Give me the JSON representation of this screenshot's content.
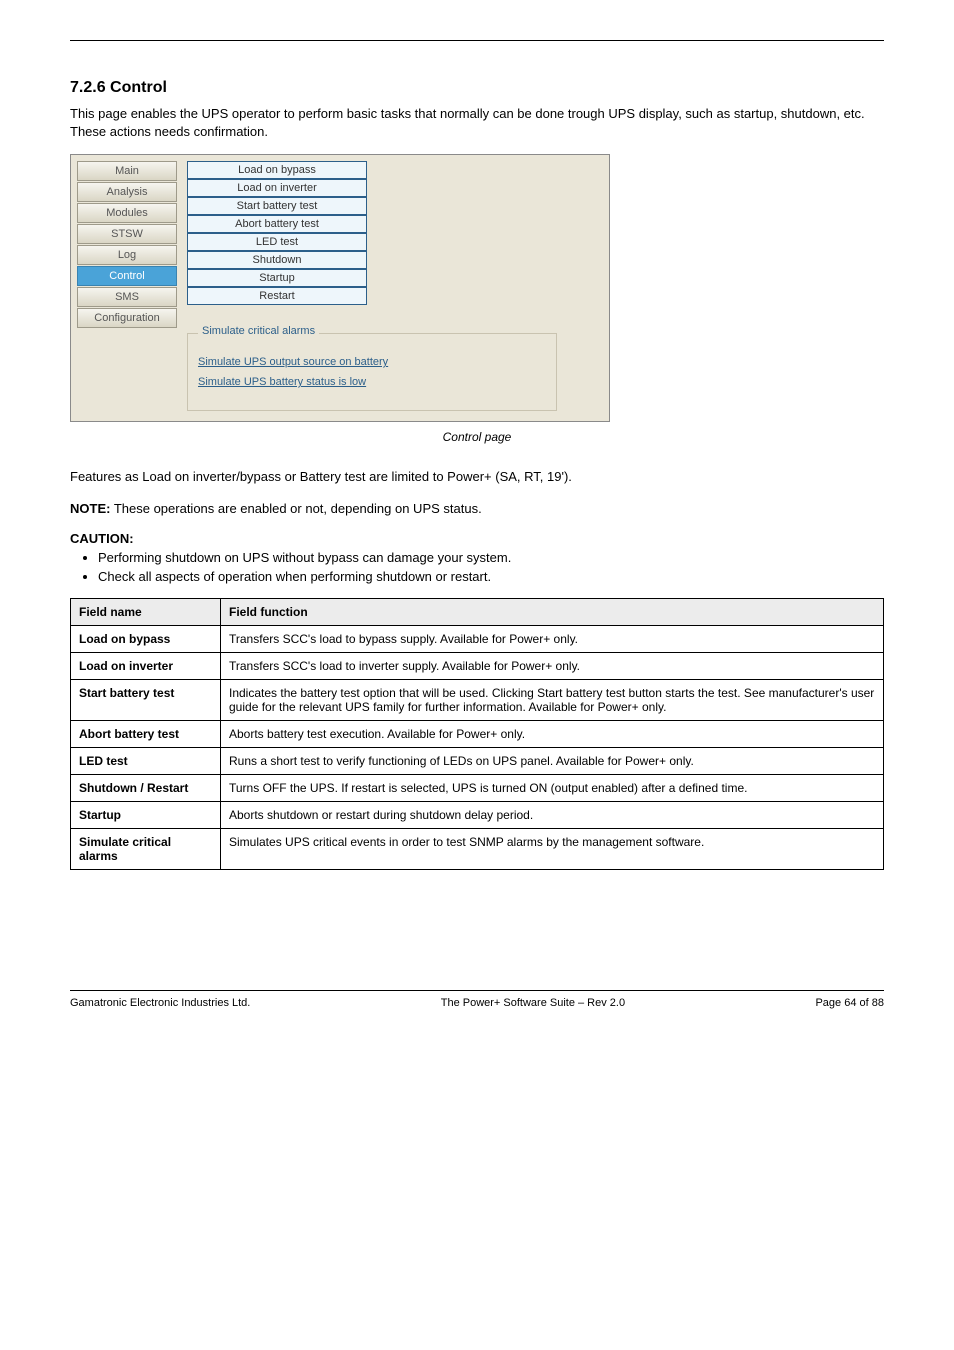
{
  "header": {
    "left": "",
    "center": "",
    "right": ""
  },
  "section": {
    "num_title": "7.2.6 Control",
    "intro": "This page enables the UPS operator to perform basic tasks that normally can be done trough UPS display, such as startup, shutdown, etc. These actions needs confirmation."
  },
  "screenshot": {
    "nav": [
      {
        "label": "Main",
        "active": false
      },
      {
        "label": "Analysis",
        "active": false
      },
      {
        "label": "Modules",
        "active": false
      },
      {
        "label": "STSW",
        "active": false
      },
      {
        "label": "Log",
        "active": false
      },
      {
        "label": "Control",
        "active": true
      },
      {
        "label": "SMS",
        "active": false
      },
      {
        "label": "Configuration",
        "active": false
      }
    ],
    "actions": [
      "Load on bypass",
      "Load on inverter",
      "Start battery test",
      "Abort battery test",
      "LED test",
      "Shutdown",
      "Startup",
      "Restart"
    ],
    "sim_group": {
      "legend": "Simulate critical alarms",
      "links": [
        "Simulate UPS output source on battery",
        "Simulate UPS battery status is low"
      ]
    }
  },
  "figure_caption": "Control page",
  "post_caption": "Features as Load on inverter/bypass or Battery test are limited to Power+ (SA, RT, 19').",
  "note": {
    "label": "NOTE:",
    "text": " These operations are enabled or not, depending on UPS status."
  },
  "caution": {
    "label": "CAUTION:",
    "items": [
      "Performing shutdown on UPS without bypass can damage your system.",
      "Check all aspects of operation when performing shutdown or restart."
    ]
  },
  "table": {
    "headers": [
      "Field name",
      "Field function"
    ],
    "rows": [
      {
        "name": "Load on bypass",
        "func": "Transfers SCC's load to bypass supply. Available for Power+ only."
      },
      {
        "name": "Load on inverter",
        "func": "Transfers SCC's load to inverter supply. Available for Power+ only."
      },
      {
        "name": "Start battery test",
        "func": "Indicates the battery test option that will be used. Clicking Start battery test button starts the test. See manufacturer's user guide for the relevant UPS family for further information. Available for Power+ only."
      },
      {
        "name": "Abort battery test",
        "func": "Aborts battery test execution. Available for Power+ only."
      },
      {
        "name": "LED test",
        "func": "Runs a short test to verify functioning of LEDs on UPS panel. Available for Power+ only."
      },
      {
        "name": "Shutdown / Restart",
        "func": "Turns OFF the UPS. If restart is selected, UPS is turned ON (output enabled) after a defined time."
      },
      {
        "name": "Startup",
        "func": "Aborts shutdown or restart during shutdown delay period."
      },
      {
        "name": "Simulate critical alarms",
        "func": "Simulates UPS critical events in order to test SNMP alarms by the management software."
      }
    ]
  },
  "footer": {
    "left": "Gamatronic Electronic Industries Ltd.",
    "center": "The Power+ Software Suite – Rev 2.0",
    "right": "Page 64 of 88"
  }
}
